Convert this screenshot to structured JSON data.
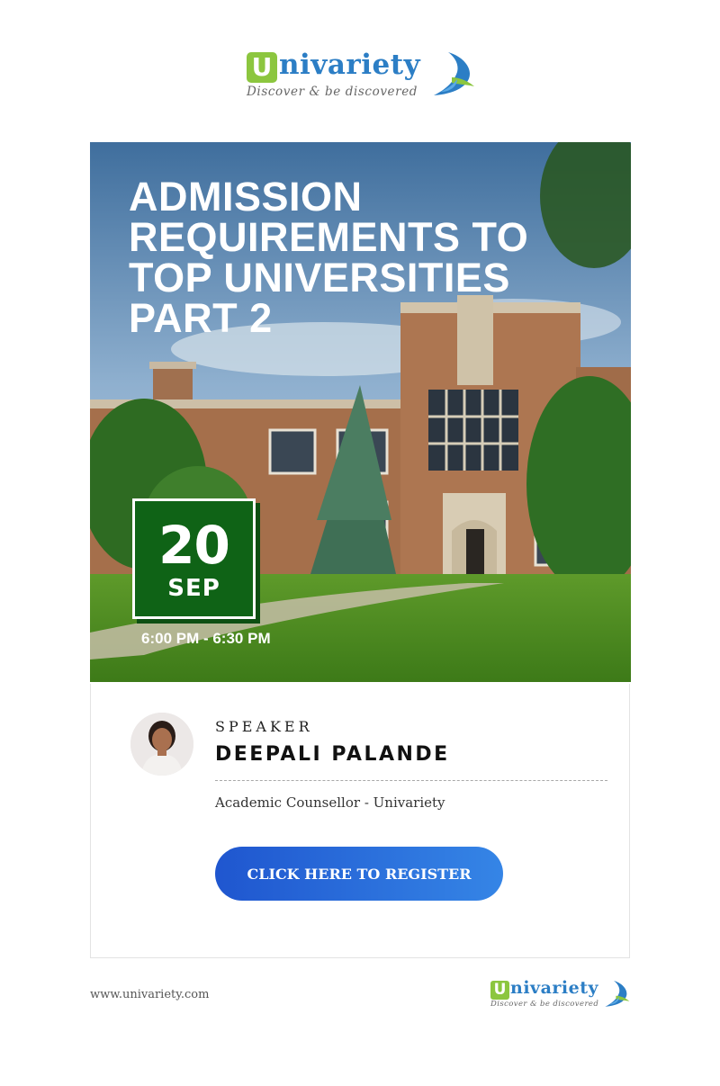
{
  "brand": {
    "name_rest": "nivariety",
    "initial": "U",
    "tagline": "Discover & be discovered",
    "colors": {
      "green": "#8cc63f",
      "blue": "#2c7ec5"
    }
  },
  "event": {
    "title_lines": [
      "ADMISSION",
      "REQUIREMENTS TO",
      "TOP UNIVERSITIES",
      "PART 2"
    ],
    "date_day": "20",
    "date_month": "SEP",
    "time": "6:00 PM - 6:30 PM",
    "date_box_color": "#0f6316"
  },
  "speaker": {
    "caption": "SPEAKER",
    "name": "DEEPALI PALANDE",
    "role": "Academic Counsellor - Univariety"
  },
  "cta": {
    "register_label": "CLICK HERE TO REGISTER",
    "gradient": [
      "#1f56cf",
      "#3585e6"
    ]
  },
  "footer": {
    "url": "www.univariety.com"
  }
}
